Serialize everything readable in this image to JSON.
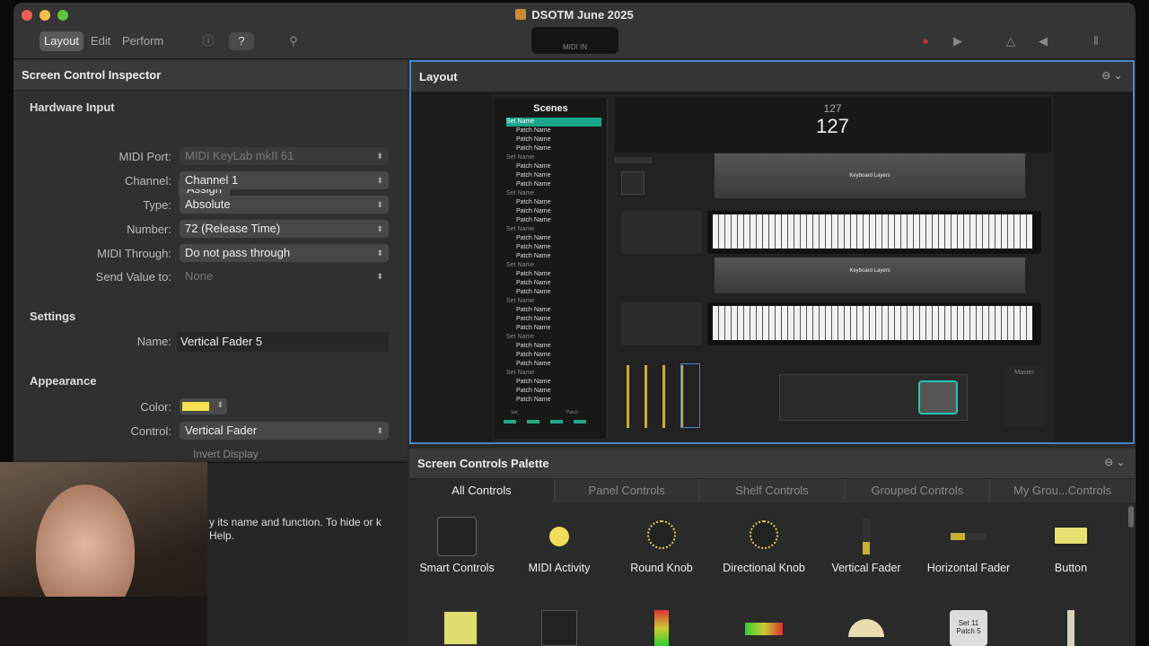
{
  "window": {
    "title": "DSOTM June 2025"
  },
  "toolbar": {
    "modes": [
      "Layout",
      "Edit",
      "Perform"
    ],
    "lcd_label": "MIDI IN"
  },
  "inspector": {
    "title": "Screen Control Inspector",
    "hardware": {
      "heading": "Hardware Input",
      "assign": "Assign",
      "midi_port_label": "MIDI Port:",
      "midi_port": "MIDI KeyLab mkII 61",
      "channel_label": "Channel:",
      "channel": "Channel 1",
      "type_label": "Type:",
      "type": "Absolute",
      "number_label": "Number:",
      "number": "72 (Release Time)",
      "through_label": "MIDI Through:",
      "through": "Do not pass through",
      "send_label": "Send Value to:",
      "send": "None"
    },
    "settings": {
      "heading": "Settings",
      "name_label": "Name:",
      "name": "Vertical Fader 5"
    },
    "appearance": {
      "heading": "Appearance",
      "color_label": "Color:",
      "color": "#f5e050",
      "control_label": "Control:",
      "control": "Vertical Fader",
      "invert": "Invert Display"
    }
  },
  "help": {
    "text": "y its name and function. To hide or k Help."
  },
  "layout": {
    "title": "Layout",
    "scenes": {
      "title": "Scenes",
      "set_label": "Set Name",
      "patch_label": "Patch Name",
      "footer": [
        "Set",
        "Patch"
      ]
    },
    "value_small": "127",
    "value_big": "127",
    "kb_layers": "Keyboard Layers",
    "master": "Master"
  },
  "palette": {
    "title": "Screen Controls Palette",
    "tabs": [
      "All Controls",
      "Panel Controls",
      "Shelf Controls",
      "Grouped Controls",
      "My Grou...Controls"
    ],
    "items": [
      "Smart Controls",
      "MIDI Activity",
      "Round Knob",
      "Directional Knob",
      "Vertical Fader",
      "Horizontal Fader",
      "Button"
    ],
    "item2_text": [
      "Set 11",
      "Patch 5"
    ]
  }
}
